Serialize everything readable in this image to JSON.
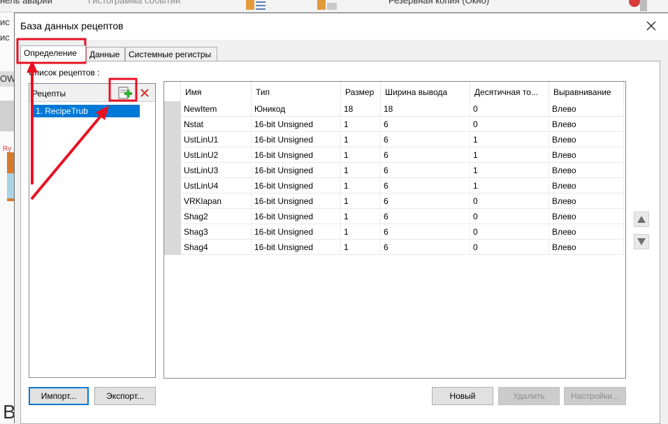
{
  "background": {
    "top_left_text": "нель аварий",
    "top_center_text": "Гистограмма событий",
    "top_right_text": "Резервная копия (Окно)",
    "left_fragment_1": "ис",
    "left_fragment_2": "ис",
    "left_fragment_3": "OW",
    "left_fragment_4": "Ry",
    "left_fragment_5": "B"
  },
  "dialog": {
    "title": "База данных рецептов",
    "tabs": [
      {
        "label": "Определение",
        "active": true
      },
      {
        "label": "Данные",
        "active": false
      },
      {
        "label": "Системные регистры",
        "active": false
      }
    ],
    "list_caption": "Список рецептов :",
    "recipes_header": "Рецепты",
    "recipes": [
      "1. RecipeTrub"
    ],
    "columns": [
      "Имя",
      "Тип",
      "Размер",
      "Ширина вывода",
      "Десятичная то...",
      "Выравнивание"
    ],
    "rows": [
      [
        "NewItem",
        "Юникод",
        "18",
        "18",
        "0",
        "Влево"
      ],
      [
        "Nstat",
        "16-bit Unsigned",
        "1",
        "6",
        "0",
        "Влево"
      ],
      [
        "UstLinU1",
        "16-bit Unsigned",
        "1",
        "6",
        "1",
        "Влево"
      ],
      [
        "UstLinU2",
        "16-bit Unsigned",
        "1",
        "6",
        "1",
        "Влево"
      ],
      [
        "UstLinU3",
        "16-bit Unsigned",
        "1",
        "6",
        "1",
        "Влево"
      ],
      [
        "UstLinU4",
        "16-bit Unsigned",
        "1",
        "6",
        "1",
        "Влево"
      ],
      [
        "VRKlapan",
        "16-bit Unsigned",
        "1",
        "6",
        "0",
        "Влево"
      ],
      [
        "Shag2",
        "16-bit Unsigned",
        "1",
        "6",
        "0",
        "Влево"
      ],
      [
        "Shag3",
        "16-bit Unsigned",
        "1",
        "6",
        "0",
        "Влево"
      ],
      [
        "Shag4",
        "16-bit Unsigned",
        "1",
        "6",
        "0",
        "Влево"
      ]
    ],
    "buttons": {
      "import": "Импорт...",
      "export": "Экспорт...",
      "new": "Новый",
      "delete": "Удалить",
      "settings": "Настройки..."
    }
  },
  "colors": {
    "selection": "#0078d7",
    "annotation": "#e81123"
  }
}
